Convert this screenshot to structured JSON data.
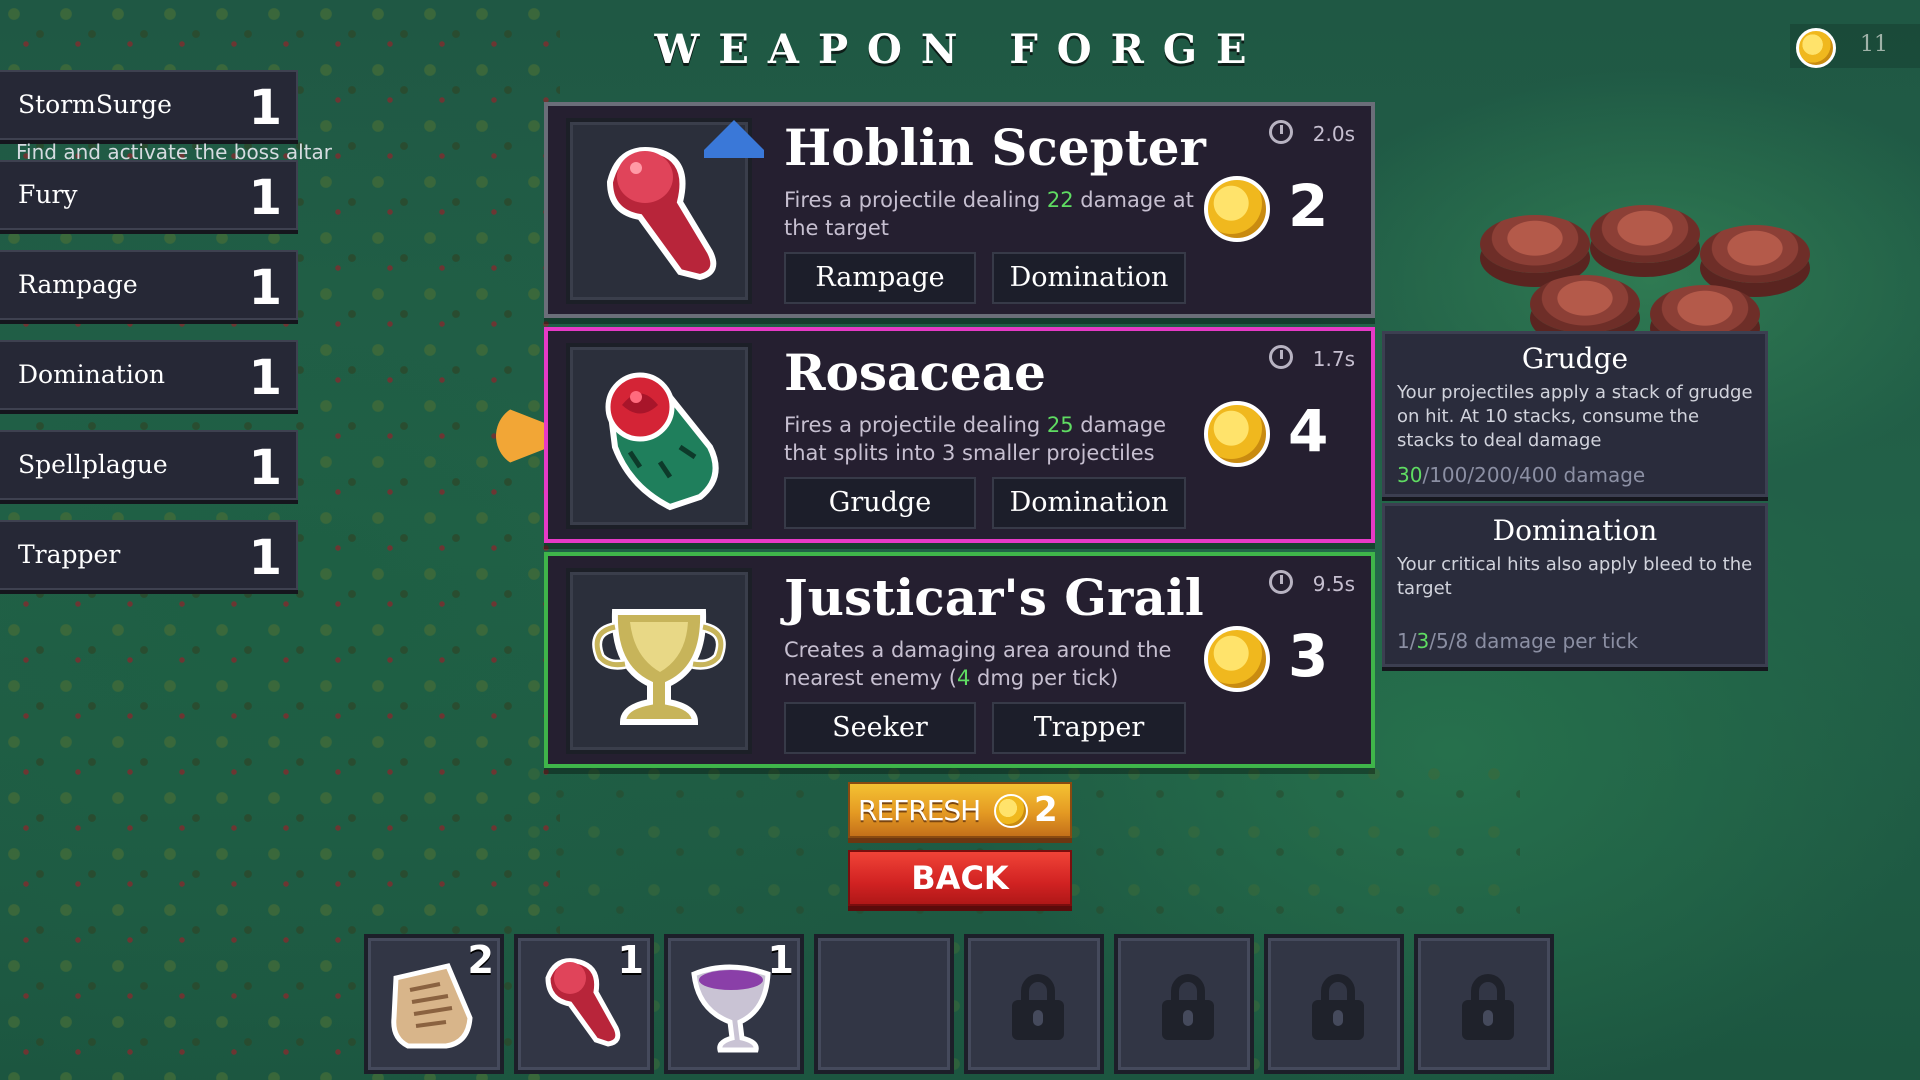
{
  "title": "WEAPON FORGE",
  "gold": "11",
  "quest_hint": "Find and activate the boss altar",
  "skills": [
    {
      "name": "StormSurge",
      "level": "1"
    },
    {
      "name": "Fury",
      "level": "1"
    },
    {
      "name": "Rampage",
      "level": "1"
    },
    {
      "name": "Domination",
      "level": "1"
    },
    {
      "name": "Spellplague",
      "level": "1"
    },
    {
      "name": "Trapper",
      "level": "1"
    }
  ],
  "cards": [
    {
      "name": "Hoblin Scepter",
      "cooldown": "2.0s",
      "desc_pre": "Fires a projectile dealing ",
      "desc_value": "22",
      "desc_post": " damage at the target",
      "price": "2",
      "tags": [
        "Rampage",
        "Domination"
      ],
      "upgrade_icon": "up-arrow-icon"
    },
    {
      "name": "Rosaceae",
      "cooldown": "1.7s",
      "desc_pre": "Fires a projectile dealing ",
      "desc_value": "25",
      "desc_post": " damage that splits into 3 smaller projectiles",
      "price": "4",
      "tags": [
        "Grudge",
        "Domination"
      ]
    },
    {
      "name": "Justicar's Grail",
      "cooldown": "9.5s",
      "desc_pre": "Creates a damaging area around the nearest enemy (",
      "desc_value": "4",
      "desc_post": " dmg per tick)",
      "price": "3",
      "tags": [
        "Seeker",
        "Trapper"
      ]
    }
  ],
  "tooltips": [
    {
      "title": "Grudge",
      "desc": "Your projectiles apply a stack of grudge on hit. At 10 stacks, consume the stacks to deal damage",
      "scale_hl": "30",
      "scale_rest": "/100/200/400 damage"
    },
    {
      "title": "Domination",
      "desc": "Your critical hits also apply bleed to the target",
      "scale_pre": "1/",
      "scale_hl": "3",
      "scale_rest": "/5/8 damage per tick"
    }
  ],
  "buttons": {
    "refresh_label": "REFRESH",
    "refresh_cost": "2",
    "back_label": "BACK"
  },
  "inventory": [
    {
      "item": "scroll-icon",
      "qty": "2"
    },
    {
      "item": "scepter-icon",
      "qty": "1"
    },
    {
      "item": "chalice-icon",
      "qty": "1"
    },
    {
      "item": "empty",
      "qty": ""
    },
    {
      "item": "lock-icon",
      "qty": ""
    },
    {
      "item": "lock-icon",
      "qty": ""
    },
    {
      "item": "lock-icon",
      "qty": ""
    },
    {
      "item": "lock-icon",
      "qty": ""
    }
  ],
  "colors": {
    "selected_border": "#e63ac6",
    "green_border": "#3fb54a",
    "default_border": "#6b6e79",
    "highlight": "#5fdc62"
  }
}
